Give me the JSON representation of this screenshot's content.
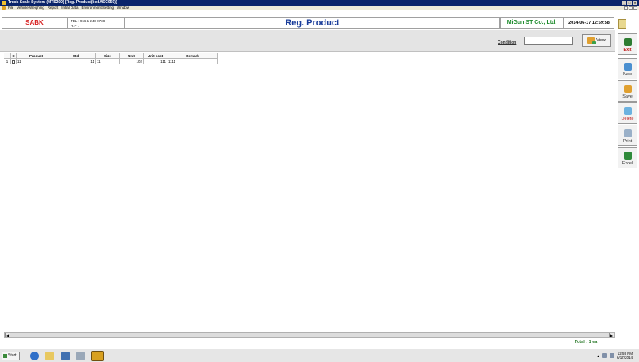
{
  "window": {
    "title": "Truck Scale System (MTS200)  [Reg. Product(bedASC050)]",
    "controls": [
      "minimize",
      "maximize",
      "close"
    ]
  },
  "menu": {
    "items": [
      "File",
      "Vehicle Weighing",
      "Report",
      "Initial Data",
      "Environment Setting",
      "Window"
    ]
  },
  "header": {
    "company_short": "SABK",
    "tel": "TEL : 966 1 248 8738",
    "hp": "H.P :",
    "page_title": "Reg. Product",
    "company": "MiGun ST Co., Ltd.",
    "datetime": "2014-06-17 12:59:58"
  },
  "toolbar": {
    "condition_label": "Condition",
    "condition_value": "",
    "view_label": "View"
  },
  "sidebar": {
    "exit": "Exit",
    "new": "New",
    "save": "Save",
    "delete": "Delete",
    "print": "Print",
    "excel": "Excel"
  },
  "grid": {
    "columns": [
      "C",
      "Product",
      "Std",
      "Size",
      "Unit",
      "Unit cost",
      "Remark"
    ],
    "rows": [
      {
        "num": "1",
        "checked": false,
        "product": "11",
        "std": "11",
        "size": "11",
        "unit": "102",
        "unit_cost": "111",
        "remark": "1111"
      }
    ]
  },
  "footer": {
    "total": "Total : 1 ea"
  },
  "taskbar": {
    "start": "Start",
    "time": "12:59 PM",
    "date": "6/17/2014"
  },
  "colors": {
    "title_bar": "#0a246a",
    "company_short": "#d62020",
    "page_title": "#1a3d9a",
    "company": "#1b8a2a",
    "total": "#2b7a2b"
  }
}
